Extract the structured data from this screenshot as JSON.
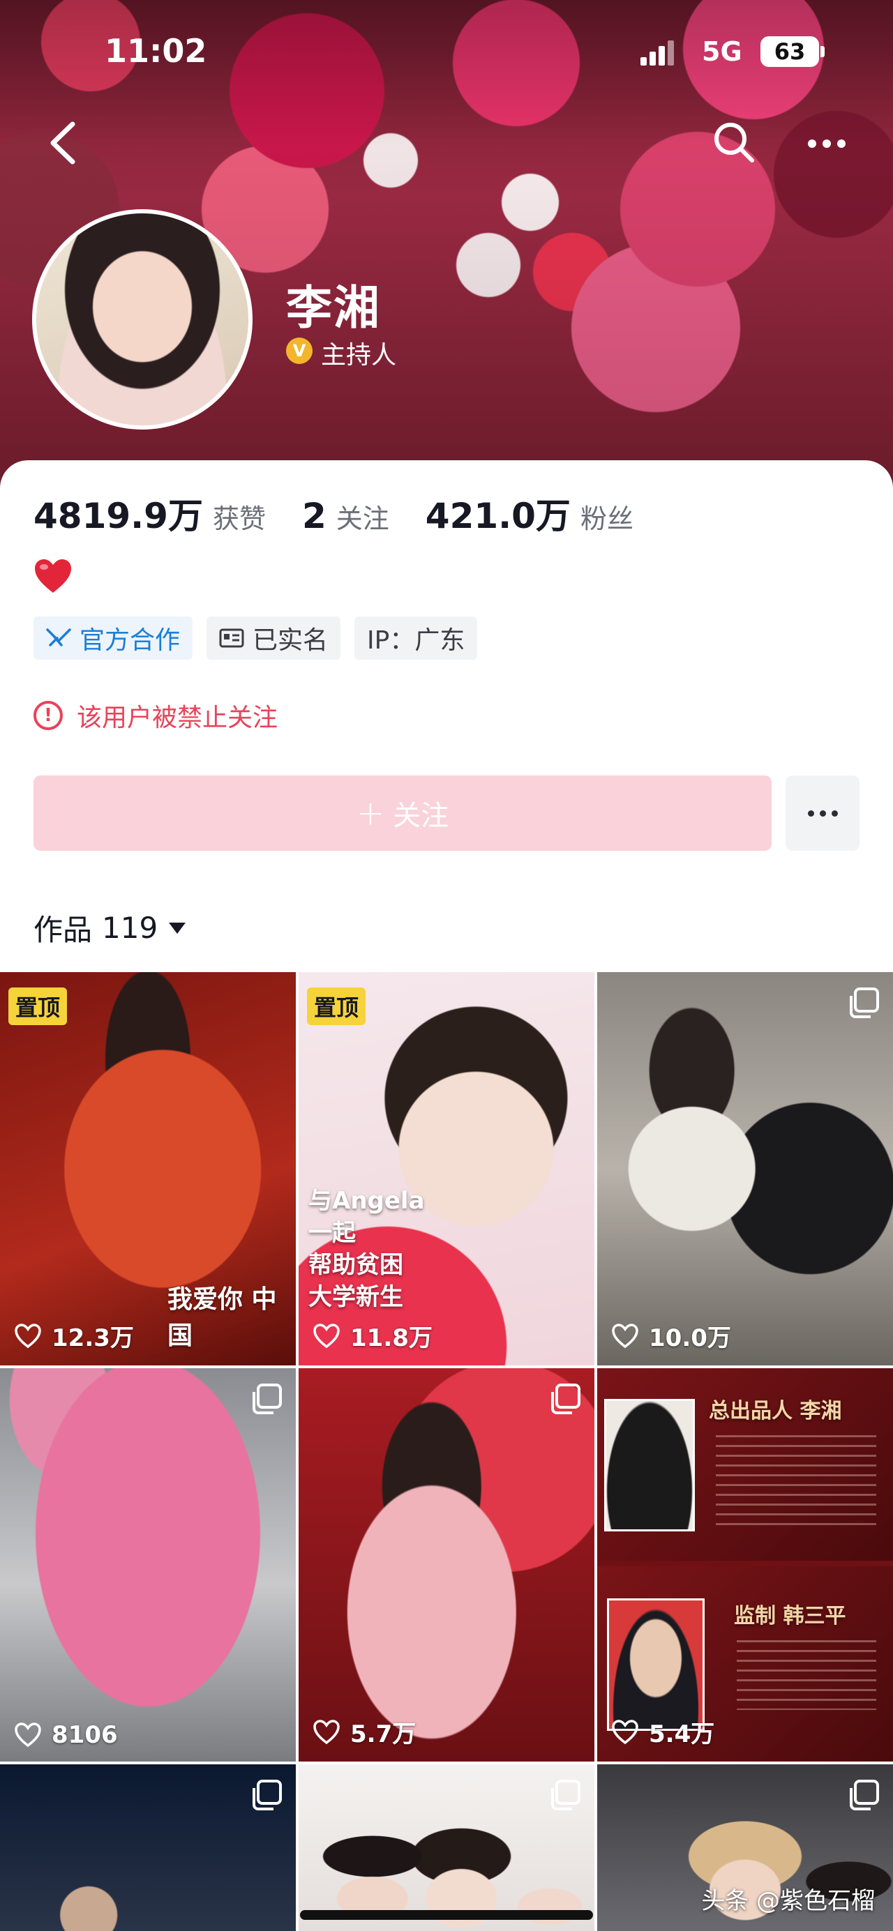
{
  "status_bar": {
    "time": "11:02",
    "network": "5G",
    "battery": "63"
  },
  "profile": {
    "name": "李湘",
    "verify_badge": "V",
    "role": "主持人",
    "stats": [
      {
        "value": "4819.9万",
        "label": "获赞"
      },
      {
        "value": "2",
        "label": "关注"
      },
      {
        "value": "421.0万",
        "label": "粉丝"
      }
    ],
    "tags": [
      "官方合作",
      "已实名",
      "IP：广东"
    ],
    "ban_notice": "该用户被禁止关注",
    "follow_label": "关注",
    "works_label": "作品",
    "works_count": "119"
  },
  "grid": {
    "pin_label": "置顶",
    "tiles": [
      {
        "likes": "12.3万",
        "pinned": true,
        "overlay": "我爱你 中国"
      },
      {
        "likes": "11.8万",
        "pinned": true,
        "overlay": [
          "与Angela",
          "一起",
          "帮助贫困",
          "大学新生"
        ]
      },
      {
        "likes": "10.0万",
        "pinned": false
      },
      {
        "likes": "8106",
        "pinned": false
      },
      {
        "likes": "5.7万",
        "pinned": false
      },
      {
        "likes": "5.4万",
        "pinned": false,
        "overlay": [
          "总出品人 李湘",
          "监制 韩三平"
        ]
      },
      {
        "likes": "",
        "pinned": false
      },
      {
        "likes": "",
        "pinned": false
      },
      {
        "likes": "",
        "pinned": false
      }
    ]
  },
  "watermark": "头条 @紫色石榴",
  "colors": {
    "accent_pink": "#f9d3d9",
    "warning_red": "#e8435a",
    "official_blue": "#1b7fd6",
    "pin_yellow": "#f7d33b"
  }
}
